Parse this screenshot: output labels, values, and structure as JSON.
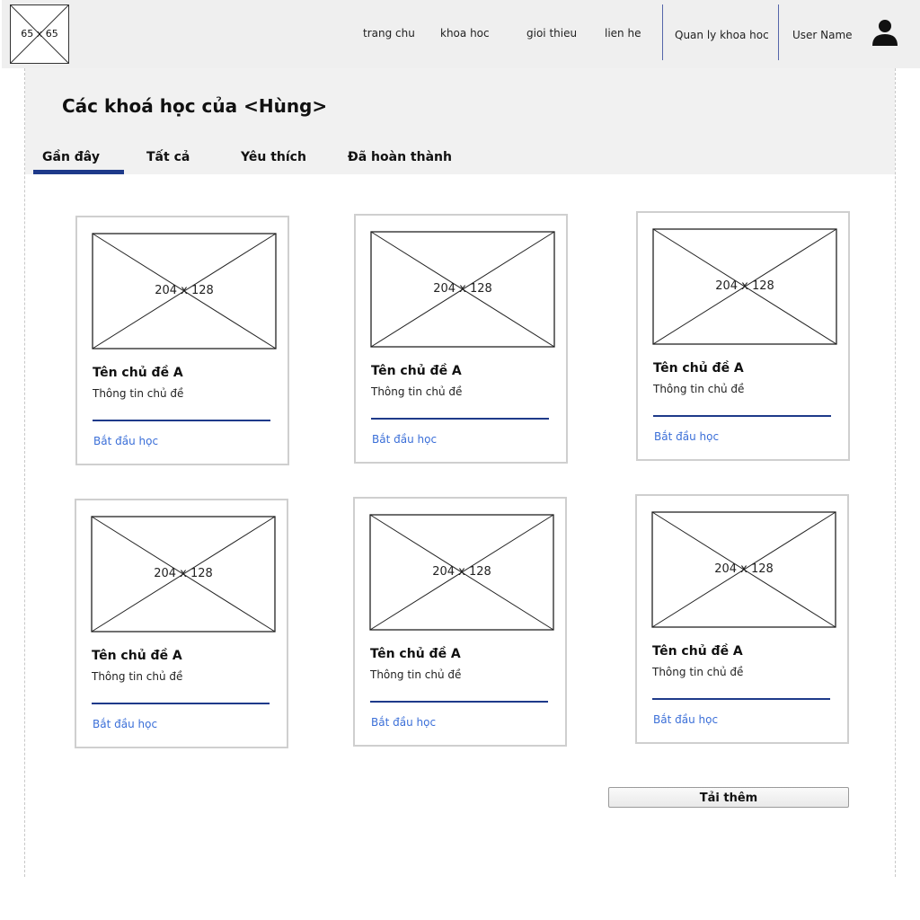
{
  "header": {
    "logo_label": "65 x 65",
    "nav": [
      "trang chu",
      "khoa hoc",
      "gioi thieu",
      "lien he",
      "Quan ly khoa hoc"
    ],
    "user_name": "User Name"
  },
  "page": {
    "title": "Các khoá học của <Hùng>"
  },
  "tabs": [
    "Gần đây",
    "Tất cả",
    "Yêu thích",
    "Đã hoàn thành"
  ],
  "active_tab": "Gần đây",
  "cards": [
    {
      "thumb": "204 x 128",
      "title": "Tên chủ đề A",
      "desc": "Thông tin chủ đề",
      "link": "Bắt đầu học"
    },
    {
      "thumb": "204 x 128",
      "title": "Tên chủ đề A",
      "desc": "Thông tin chủ đề",
      "link": "Bắt đầu học"
    },
    {
      "thumb": "204 x 128",
      "title": "Tên chủ đề A",
      "desc": "Thông tin chủ đề",
      "link": "Bắt đầu học"
    },
    {
      "thumb": "204 x 128",
      "title": "Tên chủ đề A",
      "desc": "Thông tin chủ đề",
      "link": "Bắt đầu học"
    },
    {
      "thumb": "204 x 128",
      "title": "Tên chủ đề A",
      "desc": "Thông tin chủ đề",
      "link": "Bắt đầu học"
    },
    {
      "thumb": "204 x 128",
      "title": "Tên chủ đề A",
      "desc": "Thông tin chủ đề",
      "link": "Bắt đầu học"
    }
  ],
  "load_more_label": "Tải thêm",
  "colors": {
    "accent": "#1e3a8a",
    "link": "#3b6fd8",
    "header_bg": "#efefef"
  },
  "icons": [
    "image-placeholder-icon",
    "user-icon"
  ]
}
